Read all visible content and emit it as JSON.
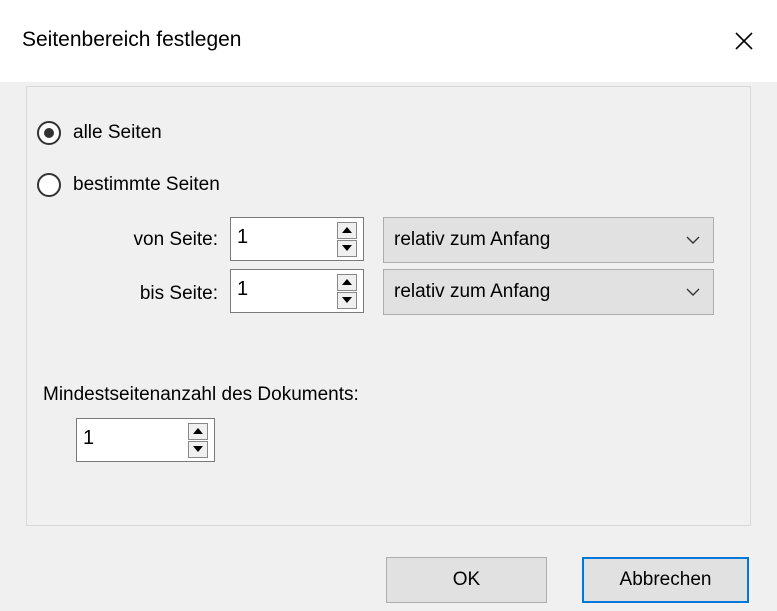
{
  "dialog": {
    "title": "Seitenbereich festlegen"
  },
  "range": {
    "all_pages_label": "alle Seiten",
    "all_pages_selected": true,
    "specific_pages_label": "bestimmte Seiten",
    "specific_pages_selected": false,
    "from_label": "von Seite:",
    "from_value": "1",
    "from_relative": "relativ zum Anfang",
    "to_label": "bis Seite:",
    "to_value": "1",
    "to_relative": "relativ zum Anfang"
  },
  "min_pages": {
    "label": "Mindestseitenanzahl des Dokuments:",
    "value": "1"
  },
  "buttons": {
    "ok_label": "OK",
    "cancel_label": "Abbrechen"
  },
  "icons": {
    "close": "close-icon",
    "chevron": "chevron-down-icon",
    "spin_up": "arrow-up-icon",
    "spin_down": "arrow-down-icon"
  }
}
